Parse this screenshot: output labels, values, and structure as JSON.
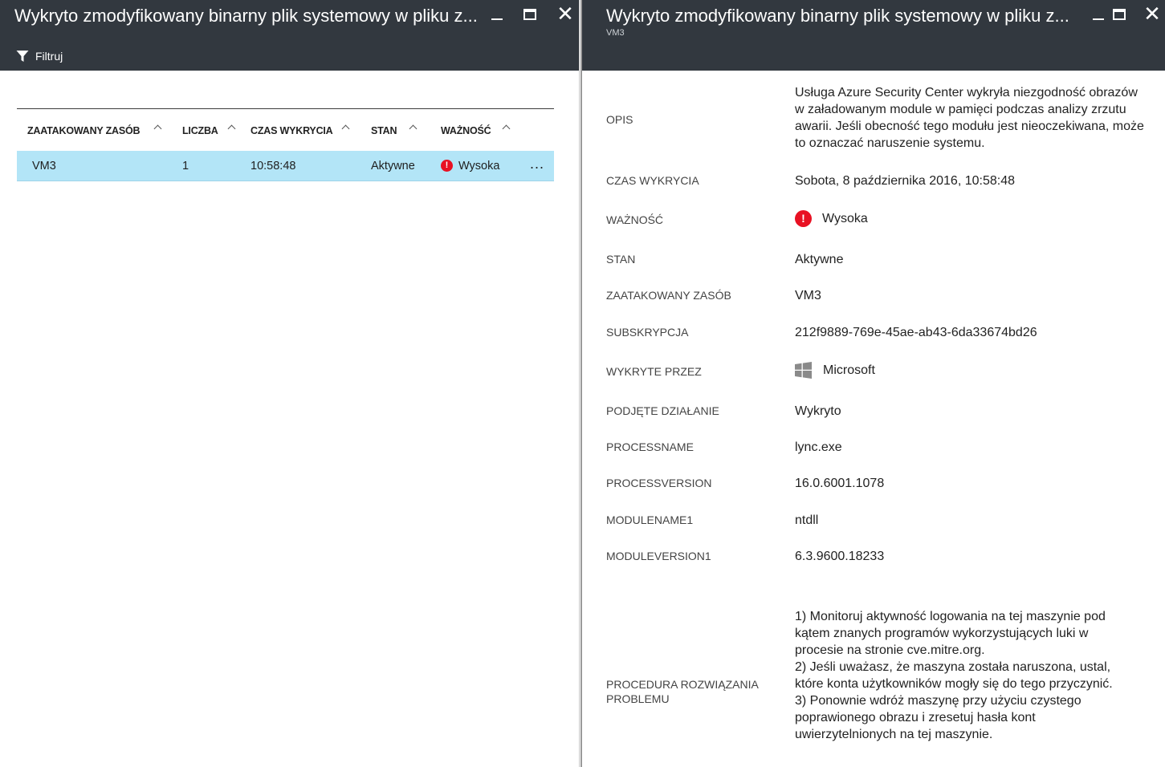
{
  "left": {
    "title": "Wykryto zmodyfikowany binarny plik systemowy w pliku z...",
    "filter_label": "Filtruj",
    "columns": [
      "ZAATAKOWANY ZASÓB",
      "LICZBA",
      "CZAS WYKRYCIA",
      "STAN",
      "WAŻNOŚĆ"
    ],
    "rows": [
      {
        "resource": "VM3",
        "count": "1",
        "time": "10:58:48",
        "state": "Aktywne",
        "severity": "Wysoka"
      }
    ],
    "more": "..."
  },
  "right": {
    "title": "Wykryto zmodyfikowany binarny plik systemowy w pliku z...",
    "subtitle": "VM3",
    "props": {
      "opis_label": "OPIS",
      "opis_value": "Usługa Azure Security Center wykryła niezgodność obrazów w załadowanym module w pamięci podczas analizy zrzutu awarii. Jeśli obecność tego modułu jest nieoczekiwana, może to oznaczać naruszenie systemu.",
      "czas_label": "CZAS WYKRYCIA",
      "czas_value": "Sobota, 8 października 2016, 10:58:48",
      "waznosc_label": "WAŻNOŚĆ",
      "waznosc_value": "Wysoka",
      "stan_label": "STAN",
      "stan_value": "Aktywne",
      "zasob_label": "ZAATAKOWANY ZASÓB",
      "zasob_value": "VM3",
      "subskrypcja_label": "SUBSKRYPCJA",
      "subskrypcja_value": "212f9889-769e-45ae-ab43-6da33674bd26",
      "wykryte_label": "WYKRYTE PRZEZ",
      "wykryte_value": "Microsoft",
      "dzialanie_label": "PODJĘTE DZIAŁANIE",
      "dzialanie_value": "Wykryto",
      "processname_label": "PROCESSNAME",
      "processname_value": "lync.exe",
      "processversion_label": "PROCESSVERSION",
      "processversion_value": "16.0.6001.1078",
      "modulename_label": "MODULENAME1",
      "modulename_value": "ntdll",
      "moduleversion_label": "MODULEVERSION1",
      "moduleversion_value": "6.3.9600.18233",
      "procedura_label": "PROCEDURA ROZWIĄZANIA PROBLEMU",
      "procedura_value": "1) Monitoruj aktywność logowania na tej maszynie pod kątem znanych programów wykorzystujących luki w procesie na stronie cve.mitre.org.\n2) Jeśli uważasz, że maszyna została naruszona, ustal, które konta użytkowników mogły się do tego przyczynić.\n3) Ponownie wdróż maszynę przy użyciu czystego poprawionego obrazu i zresetuj hasła kont uwierzytelnionych na tej maszynie."
    }
  },
  "colors": {
    "header_bg": "#32383f",
    "selected_row": "#b3e5f7",
    "severity_high": "#e81123"
  },
  "icons": [
    "filter-icon",
    "minimize-icon",
    "maximize-icon",
    "close-icon",
    "sort-ascending-icon",
    "severity-high-icon",
    "windows-logo-icon",
    "more-icon"
  ]
}
